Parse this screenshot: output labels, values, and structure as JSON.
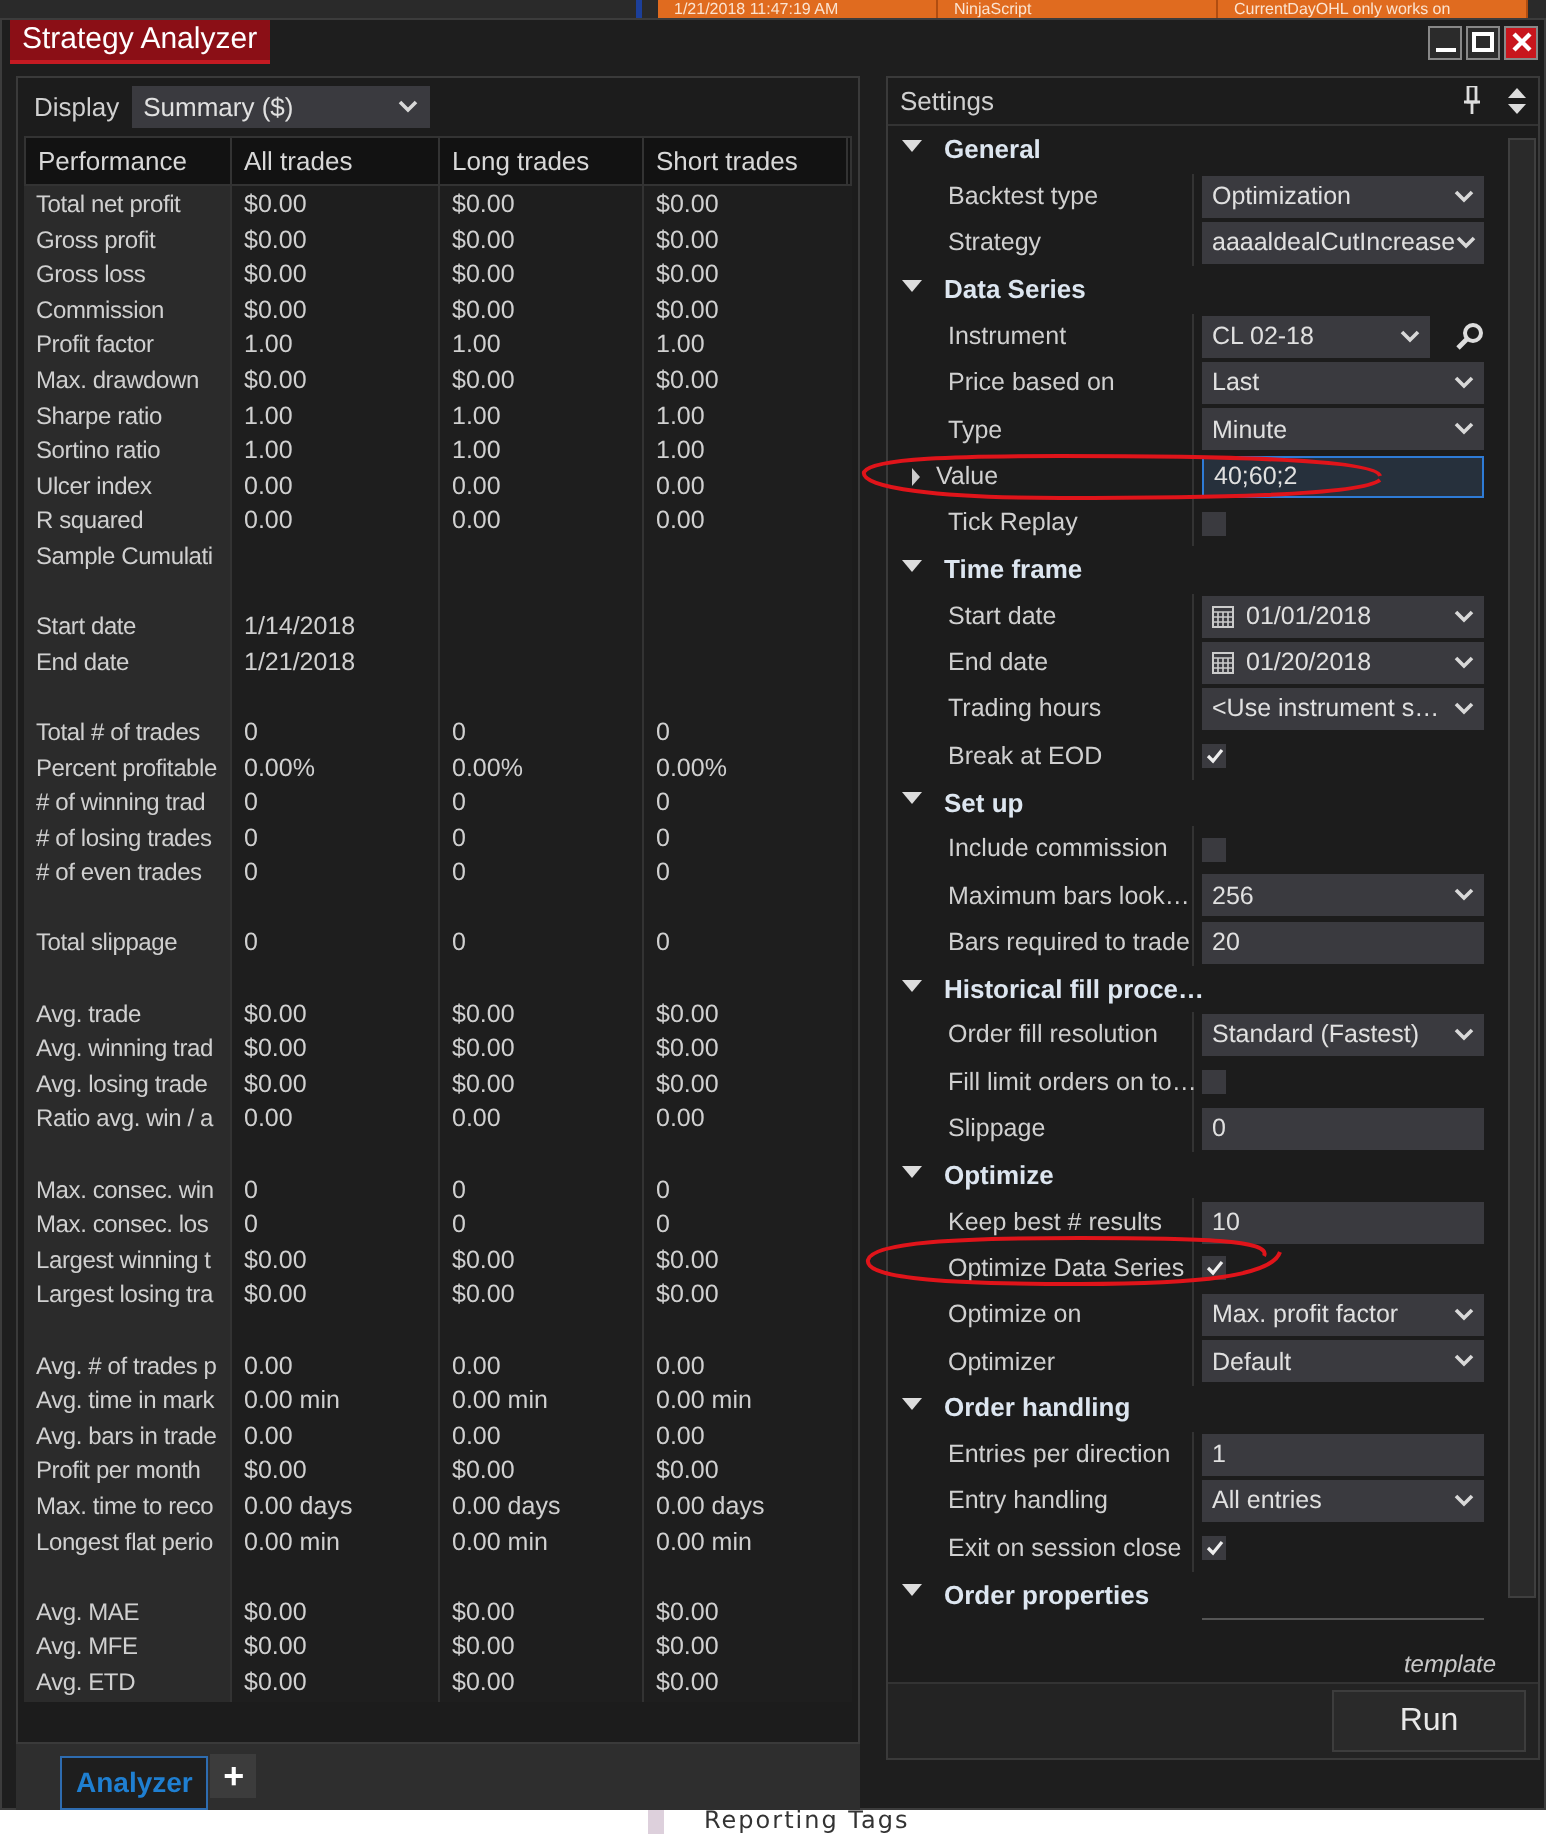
{
  "background_app": {
    "cells": [
      "1/21/2018 11:47:19 AM",
      "NinjaScript",
      "CurrentDayOHL only works on"
    ],
    "footer_text": "Reporting Tags"
  },
  "window": {
    "title": "Strategy Analyzer"
  },
  "display": {
    "label": "Display",
    "value": "Summary ($)"
  },
  "performance_table": {
    "columns": [
      "Performance",
      "All trades",
      "Long trades",
      "Short trades"
    ],
    "row_groups": [
      [
        {
          "label": "Total net profit",
          "values": [
            "$0.00",
            "$0.00",
            "$0.00"
          ]
        },
        {
          "label": "Gross profit",
          "values": [
            "$0.00",
            "$0.00",
            "$0.00"
          ]
        },
        {
          "label": "Gross loss",
          "values": [
            "$0.00",
            "$0.00",
            "$0.00"
          ]
        },
        {
          "label": "Commission",
          "values": [
            "$0.00",
            "$0.00",
            "$0.00"
          ]
        },
        {
          "label": "Profit factor",
          "values": [
            "1.00",
            "1.00",
            "1.00"
          ]
        },
        {
          "label": "Max. drawdown",
          "values": [
            "$0.00",
            "$0.00",
            "$0.00"
          ]
        },
        {
          "label": "Sharpe ratio",
          "values": [
            "1.00",
            "1.00",
            "1.00"
          ]
        },
        {
          "label": "Sortino ratio",
          "values": [
            "1.00",
            "1.00",
            "1.00"
          ]
        },
        {
          "label": "Ulcer index",
          "values": [
            "0.00",
            "0.00",
            "0.00"
          ]
        },
        {
          "label": "R squared",
          "values": [
            "0.00",
            "0.00",
            "0.00"
          ]
        },
        {
          "label": "Sample Cumulati"
        }
      ],
      [
        {
          "label": "Start date",
          "values": [
            "1/14/2018"
          ]
        },
        {
          "label": "End date",
          "values": [
            "1/21/2018"
          ]
        }
      ],
      [
        {
          "label": "Total # of trades",
          "values": [
            "0",
            "0",
            "0"
          ]
        },
        {
          "label": "Percent profitable",
          "values": [
            "0.00%",
            "0.00%",
            "0.00%"
          ]
        },
        {
          "label": "# of winning trad",
          "values": [
            "0",
            "0",
            "0"
          ]
        },
        {
          "label": "# of losing trades",
          "values": [
            "0",
            "0",
            "0"
          ]
        },
        {
          "label": "# of even trades",
          "values": [
            "0",
            "0",
            "0"
          ]
        }
      ],
      [
        {
          "label": "Total slippage",
          "values": [
            "0",
            "0",
            "0"
          ]
        }
      ],
      [
        {
          "label": "Avg. trade",
          "values": [
            "$0.00",
            "$0.00",
            "$0.00"
          ]
        },
        {
          "label": "Avg. winning trad",
          "values": [
            "$0.00",
            "$0.00",
            "$0.00"
          ]
        },
        {
          "label": "Avg. losing trade",
          "values": [
            "$0.00",
            "$0.00",
            "$0.00"
          ]
        },
        {
          "label": "Ratio avg. win / a",
          "values": [
            "0.00",
            "0.00",
            "0.00"
          ]
        }
      ],
      [
        {
          "label": "Max. consec. win",
          "values": [
            "0",
            "0",
            "0"
          ]
        },
        {
          "label": "Max. consec. los",
          "values": [
            "0",
            "0",
            "0"
          ]
        },
        {
          "label": "Largest winning t",
          "values": [
            "$0.00",
            "$0.00",
            "$0.00"
          ]
        },
        {
          "label": "Largest losing tra",
          "values": [
            "$0.00",
            "$0.00",
            "$0.00"
          ]
        }
      ],
      [
        {
          "label": "Avg. # of trades p",
          "values": [
            "0.00",
            "0.00",
            "0.00"
          ]
        },
        {
          "label": "Avg. time in mark",
          "values": [
            "0.00 min",
            "0.00 min",
            "0.00 min"
          ]
        },
        {
          "label": "Avg. bars in trade",
          "values": [
            "0.00",
            "0.00",
            "0.00"
          ]
        },
        {
          "label": "Profit per month",
          "values": [
            "$0.00",
            "$0.00",
            "$0.00"
          ]
        },
        {
          "label": "Max. time to reco",
          "values": [
            "0.00 days",
            "0.00 days",
            "0.00 days"
          ]
        },
        {
          "label": "Longest flat perio",
          "values": [
            "0.00 min",
            "0.00 min",
            "0.00 min"
          ]
        }
      ],
      [
        {
          "label": "Avg. MAE",
          "values": [
            "$0.00",
            "$0.00",
            "$0.00"
          ]
        },
        {
          "label": "Avg. MFE",
          "values": [
            "$0.00",
            "$0.00",
            "$0.00"
          ]
        },
        {
          "label": "Avg. ETD",
          "values": [
            "$0.00",
            "$0.00",
            "$0.00"
          ]
        }
      ]
    ]
  },
  "settings": {
    "title": "Settings",
    "categories": [
      {
        "name": "General",
        "expanded": true,
        "properties": [
          {
            "label": "Backtest type",
            "kind": "dropdown",
            "value": "Optimization"
          },
          {
            "label": "Strategy",
            "kind": "dropdown",
            "value": "aaaaldealCutIncrease"
          }
        ]
      },
      {
        "name": "Data Series",
        "expanded": true,
        "properties": [
          {
            "label": "Instrument",
            "kind": "instrument",
            "value": "CL 02-18"
          },
          {
            "label": "Price based on",
            "kind": "dropdown",
            "value": "Last"
          },
          {
            "label": "Type",
            "kind": "dropdown",
            "value": "Minute"
          },
          {
            "label": "Value",
            "kind": "expandable",
            "expanded": false,
            "focused": true,
            "value": "40;60;2"
          },
          {
            "label": "Tick Replay",
            "kind": "checkbox",
            "checked": false
          }
        ]
      },
      {
        "name": "Time frame",
        "expanded": true,
        "properties": [
          {
            "label": "Start date",
            "kind": "date",
            "value": "01/01/2018"
          },
          {
            "label": "End date",
            "kind": "date",
            "value": "01/20/2018"
          },
          {
            "label": "Trading hours",
            "kind": "dropdown",
            "value": "<Use instrument s…"
          },
          {
            "label": "Break at EOD",
            "kind": "checkbox",
            "checked": true
          }
        ]
      },
      {
        "name": "Set up",
        "expanded": true,
        "properties": [
          {
            "label": "Include commission",
            "kind": "checkbox",
            "checked": false
          },
          {
            "label": "Maximum bars look…",
            "kind": "dropdown",
            "value": "256"
          },
          {
            "label": "Bars required to trade",
            "kind": "text",
            "value": "20"
          }
        ]
      },
      {
        "name": "Historical fill proce…",
        "expanded": true,
        "properties": [
          {
            "label": "Order fill resolution",
            "kind": "dropdown",
            "value": "Standard (Fastest)"
          },
          {
            "label": "Fill limit orders on to…",
            "kind": "checkbox",
            "checked": false
          },
          {
            "label": "Slippage",
            "kind": "text",
            "value": "0"
          }
        ]
      },
      {
        "name": "Optimize",
        "expanded": true,
        "properties": [
          {
            "label": "Keep best # results",
            "kind": "text",
            "value": "10"
          },
          {
            "label": "Optimize Data Series",
            "kind": "checkbox",
            "checked": true
          },
          {
            "label": "Optimize on",
            "kind": "dropdown",
            "value": "Max. profit factor"
          },
          {
            "label": "Optimizer",
            "kind": "dropdown",
            "value": "Default"
          }
        ]
      },
      {
        "name": "Order handling",
        "expanded": true,
        "properties": [
          {
            "label": "Entries per direction",
            "kind": "text",
            "value": "1"
          },
          {
            "label": "Entry handling",
            "kind": "dropdown",
            "value": "All entries"
          },
          {
            "label": "Exit on session close",
            "kind": "checkbox",
            "checked": true
          }
        ]
      },
      {
        "name": "Order properties",
        "expanded": true
      }
    ]
  },
  "template_link": "template",
  "run_button": "Run",
  "tabs": [
    {
      "label": "Analyzer",
      "selected": true
    }
  ],
  "add_tab": "+"
}
